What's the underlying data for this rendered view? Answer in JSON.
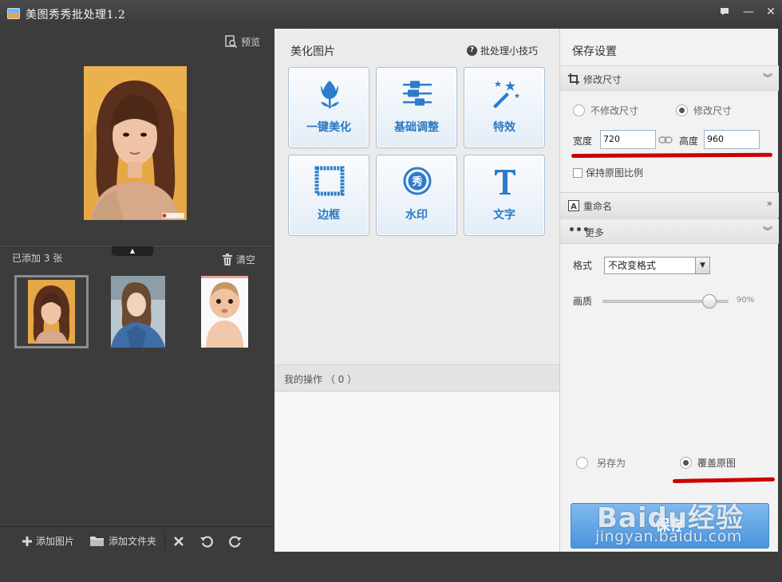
{
  "window": {
    "title": "美图秀秀批处理1.2",
    "buttons": {
      "feedback": "▪",
      "minimize": "—",
      "close": "✕"
    }
  },
  "left_panel": {
    "preview_label": "预览",
    "added_count": "已添加 3 张",
    "clear_label": "清空",
    "thumbnails": [
      "woman-with-bangs",
      "woman-selfie",
      "baby"
    ],
    "toolbar": {
      "add_images": "添加图片",
      "add_folder": "添加文件夹"
    }
  },
  "middle_panel": {
    "title": "美化图片",
    "tips_label": "批处理小技巧",
    "tools": [
      {
        "label": "一键美化",
        "icon": "tulip-icon"
      },
      {
        "label": "基础调整",
        "icon": "sliders-icon"
      },
      {
        "label": "特效",
        "icon": "magic-wand-icon"
      },
      {
        "label": "边框",
        "icon": "frame-icon"
      },
      {
        "label": "水印",
        "icon": "watermark-stamp-icon"
      },
      {
        "label": "文字",
        "icon": "text-t-icon"
      }
    ],
    "operations_label": "我的操作 （ 0 ）"
  },
  "right_panel": {
    "title": "保存设置",
    "resize": {
      "header": "修改尺寸",
      "option_keep": "不修改尺寸",
      "option_change": "修改尺寸",
      "selected": "修改尺寸",
      "width_label": "宽度",
      "width_value": "720",
      "height_label": "高度",
      "height_value": "960",
      "keep_ratio_label": "保持原图比例",
      "keep_ratio_checked": false
    },
    "rename": {
      "header": "重命名"
    },
    "more": {
      "header": "更多",
      "format_label": "格式",
      "format_value": "不改变格式",
      "quality_label": "画质",
      "quality_value": "90%",
      "quality_level": 0.9
    },
    "save_mode": {
      "save_as": "另存为",
      "overwrite": "覆盖原图",
      "selected": "覆盖原图"
    },
    "save_button": "保存"
  },
  "watermark": {
    "logo": "Baidu经验",
    "url": "jingyan.baidu.com"
  },
  "colors": {
    "accent_blue": "#2a78c2",
    "annotation_red": "#cc0000",
    "dark_bg": "#3c3c3c"
  }
}
